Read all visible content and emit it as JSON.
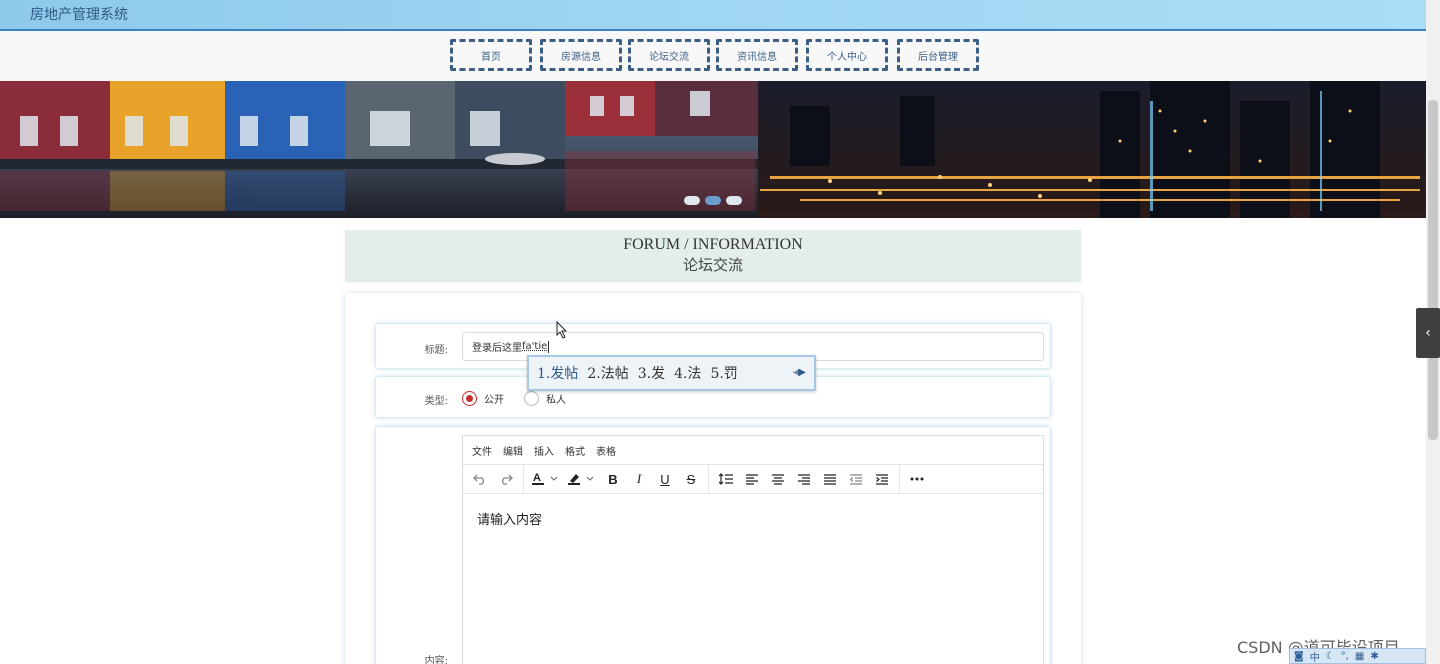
{
  "header": {
    "app_title": "房地产管理系统"
  },
  "nav": [
    {
      "label": "首页"
    },
    {
      "label": "房源信息"
    },
    {
      "label": "论坛交流"
    },
    {
      "label": "资讯信息"
    },
    {
      "label": "个人中心"
    },
    {
      "label": "后台管理"
    }
  ],
  "banner": {
    "slides": 3,
    "active_slide": 2
  },
  "section": {
    "title_en": "FORUM / INFORMATION",
    "title_zh": "论坛交流"
  },
  "form": {
    "title_label": "标题:",
    "title_value": "登录后这里",
    "title_composing": "fa'tie",
    "type_label": "类型:",
    "type_options": [
      {
        "label": "公开",
        "checked": true
      },
      {
        "label": "私人",
        "checked": false
      }
    ],
    "content_label": "内容:"
  },
  "ime": {
    "candidates": [
      "1.发帖",
      "2.法帖",
      "3.发",
      "4.法",
      "5.罚"
    ]
  },
  "editor": {
    "menu": [
      "文件",
      "编辑",
      "插入",
      "格式",
      "表格"
    ],
    "placeholder": "请输入内容",
    "toolbar_icons": [
      "undo-icon",
      "redo-icon",
      "font-color-icon",
      "highlight-color-icon",
      "bold-icon",
      "italic-icon",
      "underline-icon",
      "strikethrough-icon",
      "line-height-icon",
      "align-left-icon",
      "align-center-icon",
      "align-right-icon",
      "align-justify-icon",
      "outdent-icon",
      "indent-icon",
      "more-icon"
    ]
  },
  "watermark": "CSDN @道可毕设项目",
  "ime_tray": {
    "label": "中"
  }
}
